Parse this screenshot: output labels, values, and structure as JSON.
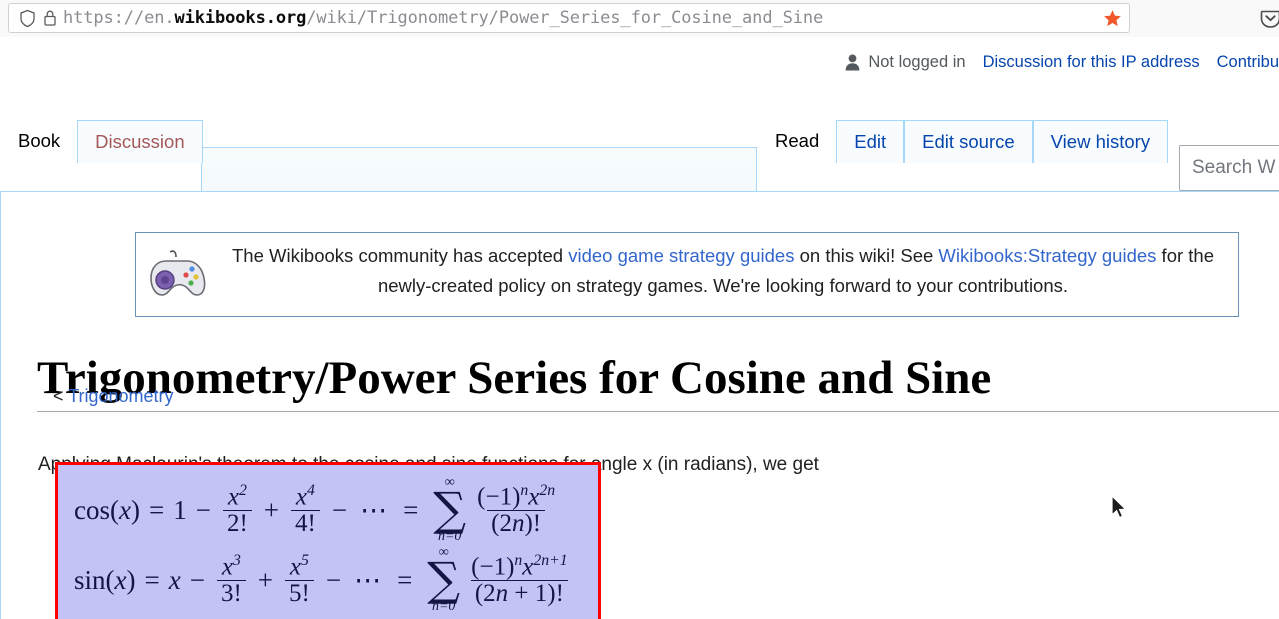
{
  "browser": {
    "url_prefix": "https://en.",
    "url_host": "wikibooks.org",
    "url_path": "/wiki/Trigonometry/Power_Series_for_Cosine_and_Sine",
    "icons": {
      "shield": "shield-icon",
      "lock": "lock-icon",
      "bookmark_star": "star-icon",
      "pocket": "pocket-icon"
    },
    "star_color": "#f0582a"
  },
  "personal_tools": {
    "user_icon": "user-icon",
    "not_logged_in": "Not logged in",
    "links": [
      "Discussion for this IP address",
      "Contribu"
    ]
  },
  "namespace_tabs": [
    {
      "label": "Book",
      "selected": true
    },
    {
      "label": "Discussion",
      "selected": false,
      "new": true
    }
  ],
  "page_action_tabs": [
    {
      "label": "Read",
      "selected": true
    },
    {
      "label": "Edit",
      "selected": false
    },
    {
      "label": "Edit source",
      "selected": false
    },
    {
      "label": "View history",
      "selected": false
    }
  ],
  "search": {
    "placeholder": "Search W",
    "value": ""
  },
  "sitenotice": {
    "icon": "gamepad-icon",
    "text_1": "The Wikibooks community has accepted ",
    "link_1": "video game strategy guides",
    "text_2": " on this wiki! See ",
    "link_2": "Wikibooks:Strategy guides",
    "text_3": " for the newly-created policy on strategy games. We're looking forward to your contributions."
  },
  "article": {
    "title": "Trigonometry/Power Series for Cosine and Sine",
    "subpage_prefix": "< ",
    "subpage_link": "Trigonometry",
    "paragraph": "Applying Maclaurin's theorem to the cosine and sine functions for angle x (in radians), we get"
  },
  "math": {
    "box_border_color": "#ff0000",
    "box_background_color": "#c3c3f5",
    "cosine": {
      "lhs": "cos(",
      "var": "x",
      "lhs_close": ") =",
      "first_term": "1",
      "minus": "−",
      "plus": "+",
      "term1_num": "x",
      "term1_exp": "2",
      "term1_den": "2!",
      "term2_num": "x",
      "term2_exp": "4",
      "term2_den": "4!",
      "dots": "⋯",
      "equals": "=",
      "sum_upper": "∞",
      "sum_lower": "n=0",
      "sum_sigma": "∑",
      "sum_num": "(−1)ⁿ x²ⁿ",
      "sum_den": "(2n)!"
    },
    "sine": {
      "lhs": "sin(",
      "var": "x",
      "lhs_close": ") =",
      "first_term": "x",
      "minus": "−",
      "plus": "+",
      "term1_num": "x",
      "term1_exp": "3",
      "term1_den": "3!",
      "term2_num": "x",
      "term2_exp": "5",
      "term2_den": "5!",
      "dots": "⋯",
      "equals": "=",
      "sum_upper": "∞",
      "sum_lower": "n=0",
      "sum_sigma": "∑",
      "sum_num": "(−1)ⁿ x²ⁿ⁺¹",
      "sum_den": "(2n + 1)!"
    }
  }
}
